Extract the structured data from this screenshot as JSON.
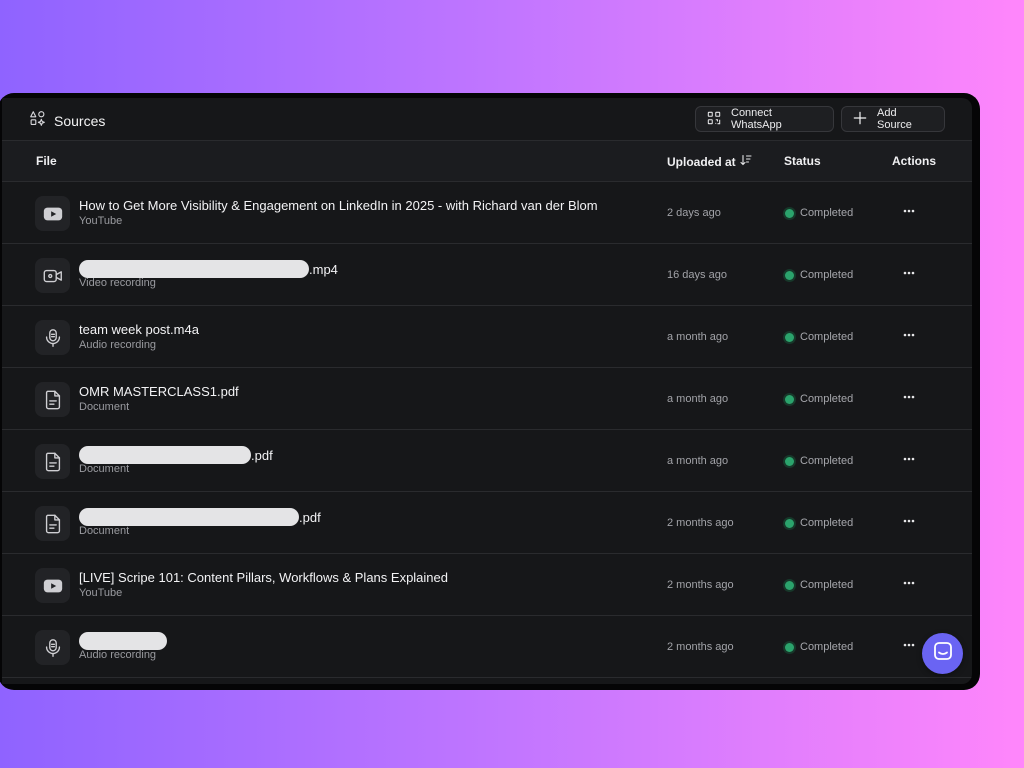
{
  "header": {
    "title": "Sources",
    "title_icon": "sources-icon",
    "connect_whatsapp_label": "Connect WhatsApp",
    "connect_whatsapp_icon": "qr-code-icon",
    "add_source_label": "Add Source",
    "add_source_icon": "plus-icon"
  },
  "columns": {
    "file": "File",
    "uploaded_at": "Uploaded at",
    "uploaded_sort_icon": "sort-descending-icon",
    "status": "Status",
    "actions": "Actions"
  },
  "rows": [
    {
      "name": "How to Get More Visibility & Engagement on LinkedIn in 2025 - with Richard van der Blom",
      "redacted": false,
      "suffix": "",
      "type": "YouTube",
      "icon": "youtube-icon",
      "uploaded": "2 days ago",
      "status": "Completed"
    },
    {
      "name": "",
      "redacted": true,
      "suffix": ".mp4",
      "type": "Video recording",
      "icon": "video-camera-icon",
      "uploaded": "16 days ago",
      "status": "Completed"
    },
    {
      "name": "team week post.m4a",
      "redacted": false,
      "suffix": "",
      "type": "Audio recording",
      "icon": "microphone-icon",
      "uploaded": "a month ago",
      "status": "Completed"
    },
    {
      "name": "OMR MASTERCLASS1.pdf",
      "redacted": false,
      "suffix": "",
      "type": "Document",
      "icon": "document-icon",
      "uploaded": "a month ago",
      "status": "Completed"
    },
    {
      "name": "",
      "redacted": true,
      "suffix": ".pdf",
      "type": "Document",
      "icon": "document-icon",
      "uploaded": "a month ago",
      "status": "Completed"
    },
    {
      "name": "",
      "redacted": true,
      "suffix": ".pdf",
      "type": "Document",
      "icon": "document-icon",
      "uploaded": "2 months ago",
      "status": "Completed"
    },
    {
      "name": "[LIVE] Scripe 101: Content Pillars, Workflows & Plans Explained",
      "redacted": false,
      "suffix": "",
      "type": "YouTube",
      "icon": "youtube-icon",
      "uploaded": "2 months ago",
      "status": "Completed"
    },
    {
      "name": "",
      "redacted": true,
      "suffix": "",
      "type": "Audio recording",
      "icon": "microphone-icon",
      "uploaded": "2 months ago",
      "status": "Completed"
    }
  ],
  "row_actions_icon": "more-horizontal-icon",
  "chat_widget_icon": "chat-bubble-icon",
  "colors": {
    "status_completed": "#2ba36c",
    "chat_widget": "#6a64f3",
    "panel_background": "#161719"
  }
}
